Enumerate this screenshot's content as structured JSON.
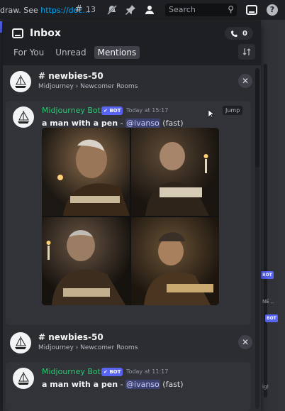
{
  "topbar": {
    "topic_prefix": "draw. See ",
    "topic_link": "https://doc...",
    "thread_count": "13",
    "search_placeholder": "Search"
  },
  "inbox": {
    "title": "Inbox",
    "mention_count": "0",
    "tabs": [
      {
        "label": "For You",
        "active": false
      },
      {
        "label": "Unread",
        "active": false
      },
      {
        "label": "Mentions",
        "active": true
      }
    ]
  },
  "groups": [
    {
      "channel": "newbies-50",
      "path": "Midjourney › Newcomer Rooms",
      "message": {
        "author": "Midjourney Bot",
        "bot_tag": "BOT",
        "timestamp": "Today at 15:17",
        "prompt": "a man with a pen",
        "sep": " - ",
        "mention": "@ivanso",
        "mode": "(fast)",
        "jump": "Jump"
      }
    },
    {
      "channel": "newbies-50",
      "path": "Midjourney › Newcomer Rooms",
      "message": {
        "author": "Midjourney Bot",
        "bot_tag": "BOT",
        "timestamp": "Today at 11:17",
        "prompt": "a man with a pen",
        "sep": " - ",
        "mention": "@ivanso",
        "mode": "(fast)"
      }
    }
  ],
  "right_edge": {
    "bot_tag_1": "BOT",
    "text_1": "NE ..",
    "bot_tag_2": "BOT",
    "text_2": "ig!"
  },
  "colors": {
    "accent": "#5865f2",
    "bot_author": "#2dc770",
    "link": "#00a8fc"
  }
}
